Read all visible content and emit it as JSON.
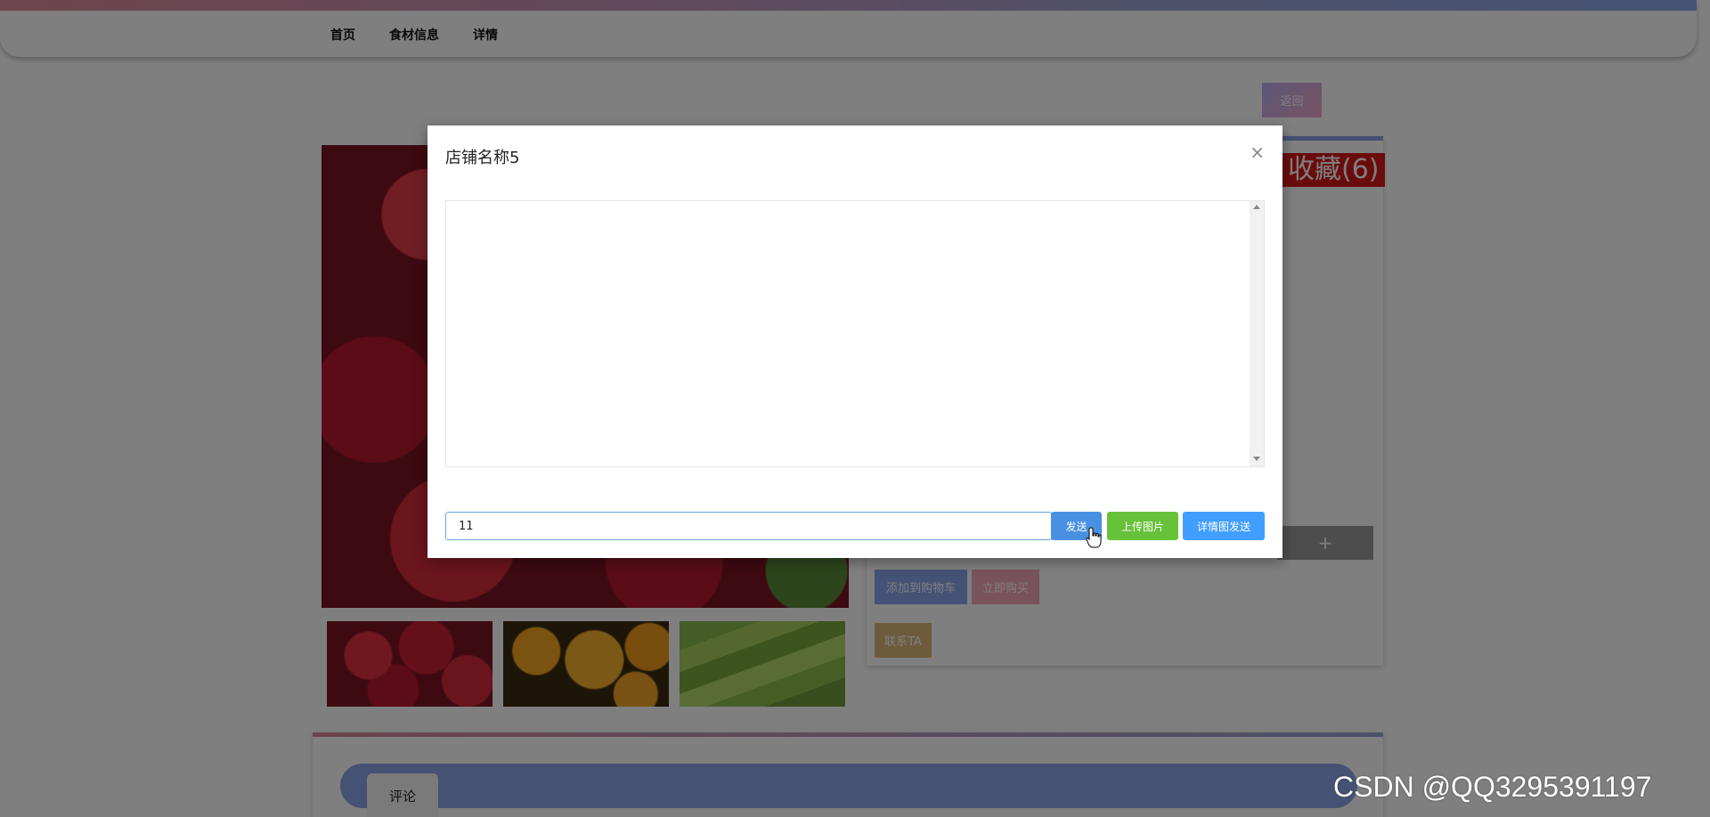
{
  "nav": {
    "items": [
      "首页",
      "食材信息",
      "详情"
    ]
  },
  "page": {
    "back_label": "返回",
    "favorite_label": "收藏(6)",
    "qty_plus": "+"
  },
  "actions": {
    "add_to_cart": "添加到购物车",
    "buy_now": "立即购买",
    "contact": "联系TA"
  },
  "comments": {
    "tab_label": "评论"
  },
  "modal": {
    "title": "店铺名称5",
    "close": "×",
    "message_value": "11",
    "send_label": "发送",
    "upload_label": "上传图片",
    "detail_send_label": "详情图发送"
  },
  "watermark": "CSDN @QQ3295391197",
  "colors": {
    "accent_blue": "#409eff",
    "green": "#67c23a",
    "fav_red": "#d41818"
  }
}
